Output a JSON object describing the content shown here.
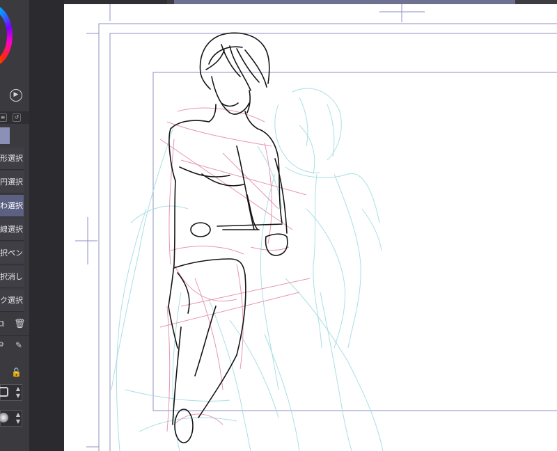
{
  "app": {
    "accent_color": "#5c6184",
    "canvas_background": "#ffffff"
  },
  "toolbar": {
    "play_icon": "play-icon",
    "tab_icons": [
      "layer-tab-icon",
      "reset-tab-icon"
    ]
  },
  "tools": [
    {
      "label": "形選択",
      "active": false
    },
    {
      "label": "円選択",
      "active": false
    },
    {
      "label": "わ選択",
      "active": true
    },
    {
      "label": "線選択",
      "active": false
    },
    {
      "label": "択ペン",
      "active": false
    },
    {
      "label": "択消し",
      "active": false
    },
    {
      "label": "ク選択",
      "active": false
    }
  ],
  "bottom_icons": {
    "copy": "copy-icon",
    "delete": "trash-icon",
    "lock": "lock-icon",
    "pen": "pen-icon"
  },
  "layers": {
    "colors": {
      "rough": "#a6dde2",
      "pink": "#e58aa8",
      "ink": "#141414",
      "frame": "#8f8fc3"
    }
  }
}
